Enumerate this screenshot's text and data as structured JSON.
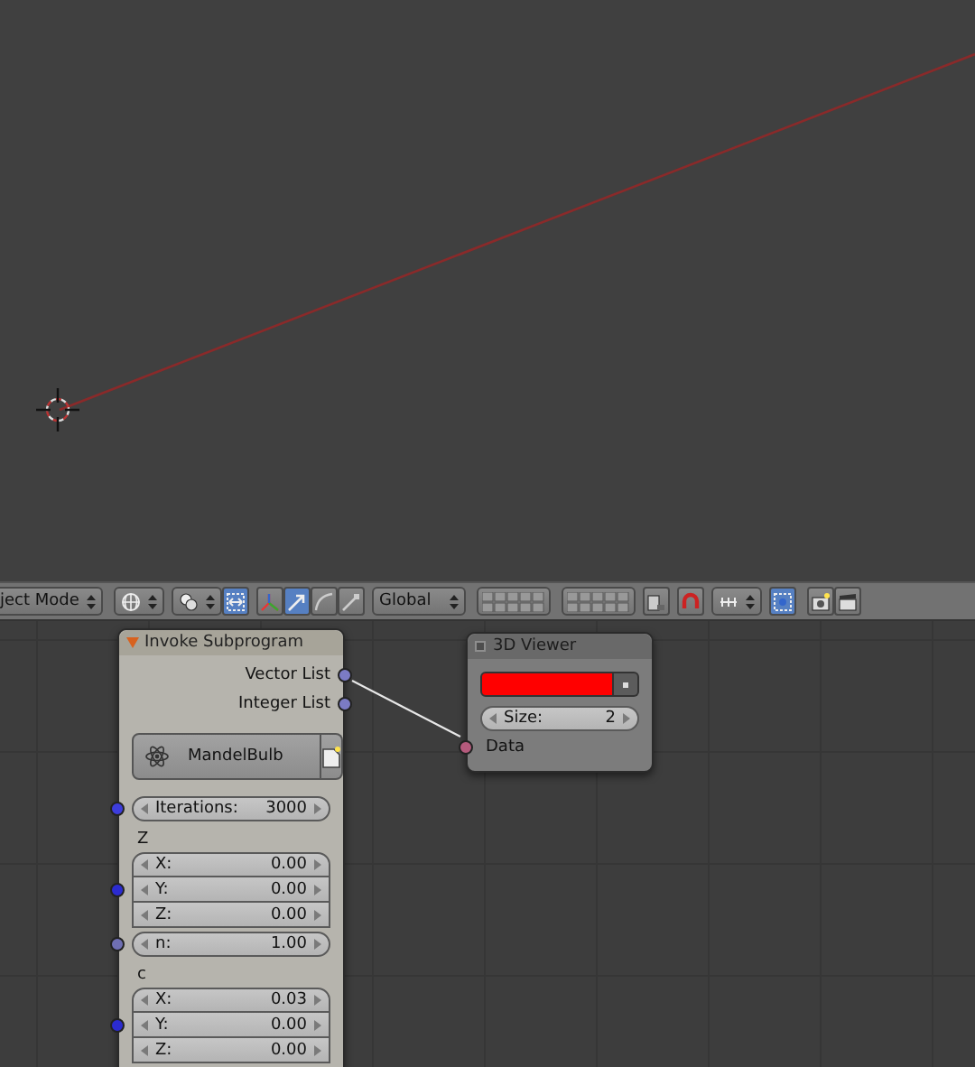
{
  "toolbar": {
    "mode": "ject Mode",
    "orientation": "Global"
  },
  "nodes": [
    {
      "kind": "invoke",
      "title": "Invoke Subprogram",
      "outputs": [
        {
          "label": "Vector List",
          "color": "#7b7bc4"
        },
        {
          "label": "Integer List",
          "color": "#7b7bc4"
        }
      ],
      "program": "MandelBulb",
      "rows": [
        {
          "kind": "field",
          "label": "Iterations:",
          "value": "3000",
          "color": "#3d3ddc"
        },
        {
          "kind": "label",
          "label": "Z"
        },
        {
          "kind": "vector",
          "color": "#2b2bd0",
          "components": [
            {
              "label": "X:",
              "value": "0.00"
            },
            {
              "label": "Y:",
              "value": "0.00"
            },
            {
              "label": "Z:",
              "value": "0.00"
            }
          ]
        },
        {
          "kind": "field",
          "label": "n:",
          "value": "1.00",
          "color": "#6f6fb3"
        },
        {
          "kind": "label",
          "label": "c"
        },
        {
          "kind": "vector",
          "color": "#2b2bd0",
          "components": [
            {
              "label": "X:",
              "value": "0.03"
            },
            {
              "label": "Y:",
              "value": "0.00"
            },
            {
              "label": "Z:",
              "value": "0.00"
            }
          ]
        }
      ]
    },
    {
      "kind": "viewer",
      "title": "3D Viewer",
      "color": "#ff0000",
      "size_label": "Size:",
      "size_value": "2",
      "input": {
        "label": "Data",
        "color": "#b45a7c"
      }
    }
  ]
}
